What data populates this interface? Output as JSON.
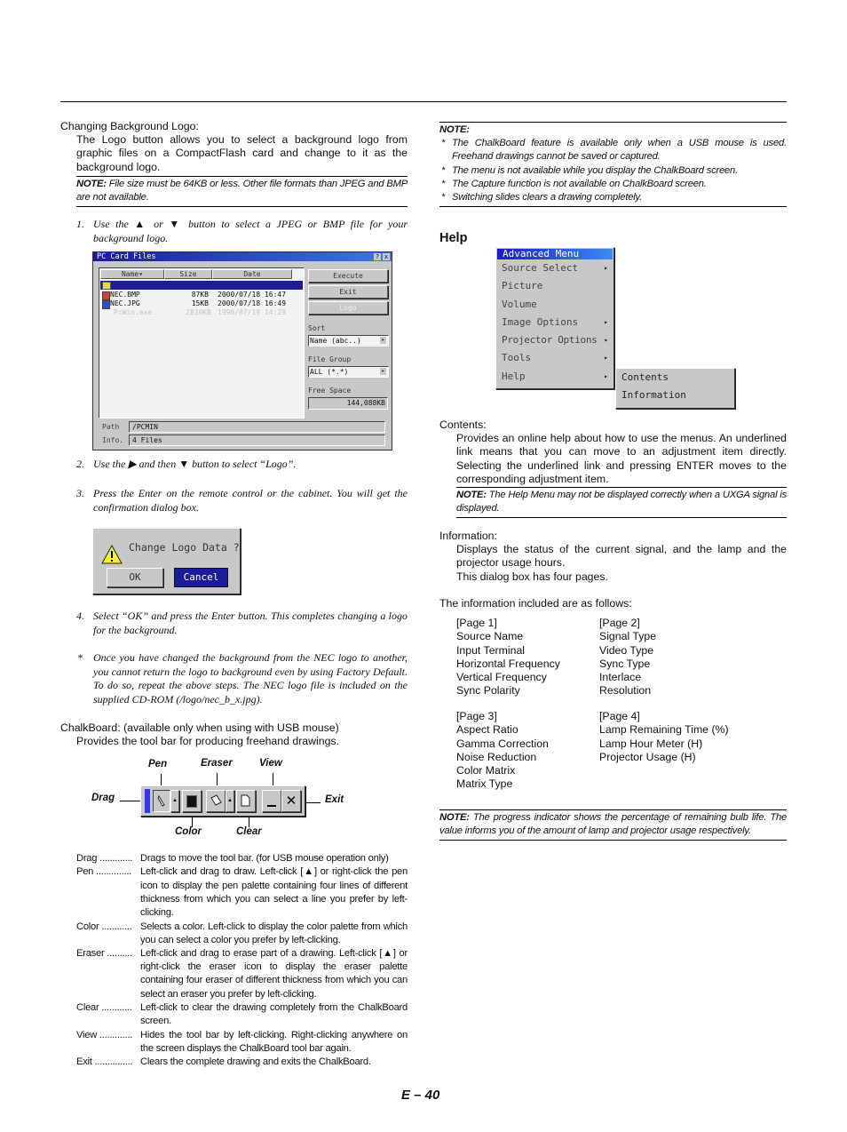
{
  "left": {
    "section_title": "Changing Background Logo:",
    "intro": "The Logo button allows you to select a background logo from graphic files on a CompactFlash card and change to it as the background logo.",
    "note_label": "NOTE:",
    "note_text": " File size must be 64KB or less. Other file formats than JPEG and BMP are not available.",
    "step1_num": "1.",
    "step1": "Use the ▲ or ▼ button to select a JPEG or BMP file for your background logo.",
    "pc_card": {
      "title": "PC Card Files",
      "help_btn": "?",
      "close_btn": "x",
      "columns": [
        "Name▾",
        "Size",
        "Date"
      ],
      "rows": [
        {
          "name": "",
          "size": "",
          "date": "",
          "type": "folder",
          "selected": true
        },
        {
          "name": "NEC.BMP",
          "size": "87KB",
          "date": "2000/07/18  16:47",
          "type": "bmp"
        },
        {
          "name": "NEC.JPG",
          "size": "15KB",
          "date": "2000/07/18  16:49",
          "type": "jpg"
        },
        {
          "name": "PcWin.exe",
          "size": "2830KB",
          "date": "1996/07/19  14:29",
          "type": "disabled"
        }
      ],
      "execute": "Execute",
      "exit": "Exit",
      "logo": "Logo",
      "sort_label": "Sort",
      "sort_value": "Name (abc..)",
      "file_group_label": "File Group",
      "file_group_value": "ALL (*.*)",
      "free_space_label": "Free Space",
      "free_space_value": "144,088KB",
      "path_label": "Path",
      "path_value": "/PCMIN",
      "info_label": "Info.",
      "info_value": "4 Files"
    },
    "step2_num": "2.",
    "step2": "Use the ▶ and then ▼ button to select “Logo”.",
    "step3_num": "3.",
    "step3": "Press the Enter on the remote control or the cabinet. You will get the confirmation dialog box.",
    "dialog": {
      "message": "Change Logo Data ?",
      "ok": "OK",
      "cancel": "Cancel"
    },
    "step4_num": "4.",
    "step4": "Select “OK” and press the Enter button. This completes changing a logo for the background.",
    "asterisk": "*",
    "asterisk_note": "Once you have changed the background from the NEC logo to another, you cannot return the logo to background even by using Factory Default. To do so, repeat the above steps. The NEC logo file is included on the supplied CD-ROM (/logo/nec_b_x.jpg).",
    "chalk_title": "ChalkBoard: (available only when using with USB mouse)",
    "chalk_intro": "Provides the tool bar for producing freehand drawings.",
    "toolbar_labels": {
      "pen": "Pen",
      "eraser": "Eraser",
      "view": "View",
      "drag": "Drag",
      "exit": "Exit",
      "color": "Color",
      "clear": "Clear"
    },
    "definitions": [
      {
        "term": "Drag .............",
        "desc": "Drags to move the tool bar. (for USB mouse operation only)"
      },
      {
        "term": "Pen ..............",
        "desc": "Left-click and drag to draw. Left-click [▲] or right-click the pen icon to display the pen palette containing four lines of different thickness from which you can select a line you prefer by left-clicking."
      },
      {
        "term": "Color ............",
        "desc": "Selects a color. Left-click to display the color palette from which you can select a color you prefer by left-clicking."
      },
      {
        "term": "Eraser ..........",
        "desc": "Left-click and drag to erase part of a drawing. Left-click [▲] or right-click the eraser icon to display the eraser palette containing four eraser of different thickness from which you can select an eraser you prefer by left-clicking."
      },
      {
        "term": "Clear ............",
        "desc": "Left-click to clear the drawing completely from the ChalkBoard screen."
      },
      {
        "term": "View .............",
        "desc": "Hides the tool bar by left-clicking. Right-clicking anywhere on the screen displays the ChalkBoard tool bar again."
      },
      {
        "term": "Exit ...............",
        "desc": "Clears the complete drawing and exits the ChalkBoard."
      }
    ]
  },
  "right": {
    "note_label": "NOTE:",
    "notes": [
      "The ChalkBoard feature is available only when a USB mouse is used. Freehand drawings cannot be saved or captured.",
      "The menu is not available while you display the ChalkBoard screen.",
      "The Capture function is not available on ChalkBoard screen.",
      "Switching slides clears a drawing completely."
    ],
    "bullet": "*",
    "help_heading": "Help",
    "menu": {
      "title": "Advanced Menu",
      "items": [
        {
          "label": "Source Select",
          "arrow": "▸"
        },
        {
          "label": "Picture",
          "arrow": ""
        },
        {
          "label": "Volume",
          "arrow": ""
        },
        {
          "label": "Image Options",
          "arrow": "▸"
        },
        {
          "label": "Projector Options",
          "arrow": "▸"
        },
        {
          "label": "Tools",
          "arrow": "▸"
        },
        {
          "label": "Help",
          "arrow": "▸"
        }
      ],
      "submenu": [
        "Contents",
        "Information"
      ]
    },
    "contents_title": "Contents:",
    "contents_text": "Provides an online help about how to use the menus. An underlined link means that you can move to an adjustment item directly. Selecting the underlined link and pressing ENTER moves to the corresponding adjustment item.",
    "contents_note_label": "NOTE:",
    "contents_note": " The Help Menu may not be displayed correctly when a UXGA signal is displayed.",
    "info_title": "Information:",
    "info_text1": "Displays the status of the current signal, and the lamp and the projector usage hours.",
    "info_text2": "This dialog box has four pages.",
    "info_included": "The information included are as follows:",
    "pages": [
      {
        "title": "[Page 1]",
        "items": [
          "Source Name",
          "Input Terminal",
          "Horizontal Frequency",
          "Vertical Frequency",
          "Sync Polarity"
        ]
      },
      {
        "title": "[Page 2]",
        "items": [
          "Signal Type",
          "Video Type",
          "Sync Type",
          "Interlace",
          "Resolution"
        ]
      },
      {
        "title": "[Page 3]",
        "items": [
          "Aspect Ratio",
          "Gamma Correction",
          "Noise Reduction",
          "Color Matrix",
          "Matrix Type"
        ]
      },
      {
        "title": "[Page 4]",
        "items": [
          "Lamp Remaining Time (%)",
          "Lamp Hour Meter (H)",
          "Projector Usage (H)"
        ]
      }
    ],
    "final_note_label": "NOTE:",
    "final_note": " The progress indicator shows the percentage of remaining bulb life. The value informs you of the amount of lamp and projector usage respectively."
  },
  "footer": {
    "page_number": "E – 40"
  }
}
